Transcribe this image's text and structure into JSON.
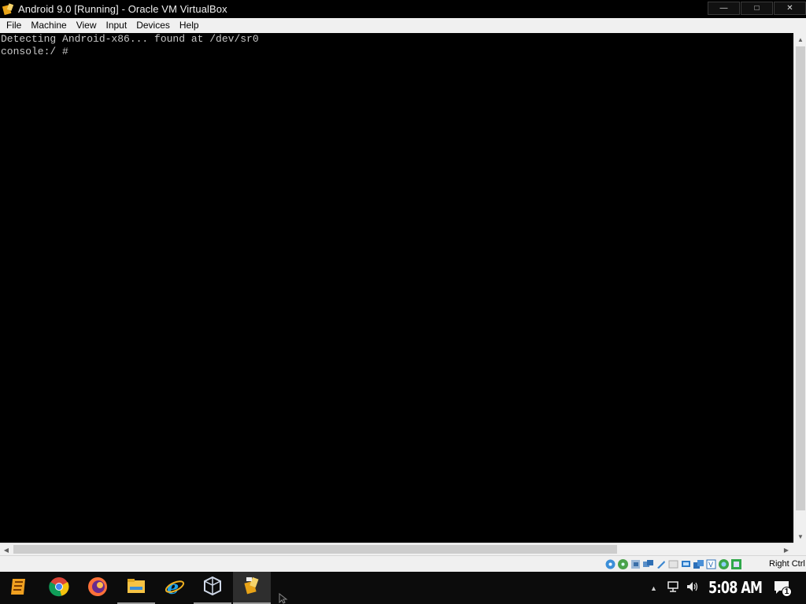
{
  "window": {
    "title": "Android 9.0 [Running] - Oracle VM VirtualBox",
    "minimize_icon": "minimize-icon",
    "maximize_icon": "maximize-icon",
    "close_icon": "close-icon"
  },
  "menubar": {
    "items": [
      "File",
      "Machine",
      "View",
      "Input",
      "Devices",
      "Help"
    ]
  },
  "console": {
    "lines": [
      "Detecting Android-x86... found at /dev/sr0",
      "console:/ # "
    ]
  },
  "statusbar": {
    "icons": [
      "hard-disk-icon",
      "optical-drive-icon",
      "audio-icon",
      "network-icon",
      "usb-icon",
      "shared-folders-icon",
      "display-icon",
      "video-capture-icon",
      "cpu-icon",
      "mouse-integration-icon",
      "keyboard-icon"
    ],
    "host_key": "Right Ctrl"
  },
  "taskbar": {
    "apps": [
      "start-icon",
      "chrome-icon",
      "firefox-icon",
      "file-explorer-icon",
      "internet-explorer-icon",
      "virtualbox-manager-icon",
      "virtualbox-vm-icon"
    ],
    "clock": "5:08 AM",
    "notification_count": "1"
  }
}
